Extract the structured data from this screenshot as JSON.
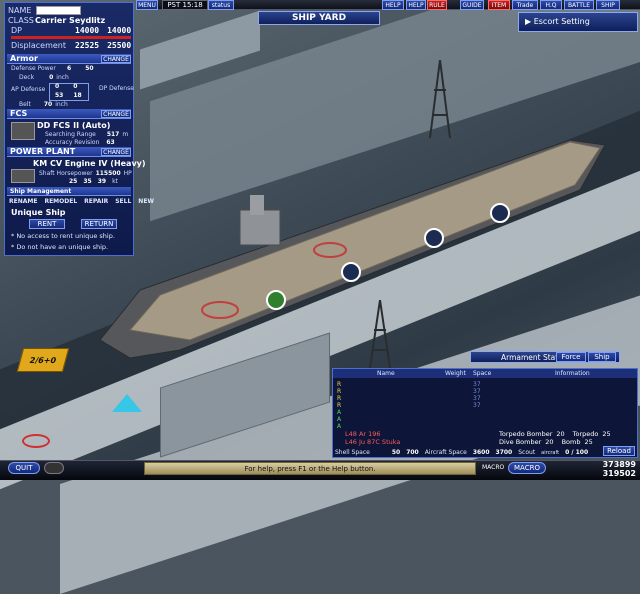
{
  "colors": {
    "panel": "#142266",
    "accent": "#3a5bc0",
    "danger": "#c22222",
    "menu_red": "#b01818",
    "target_green": "#2f7f2f"
  },
  "topbar": {
    "menu_label": "MENU",
    "time": "PST 15:18",
    "status": "status",
    "help": "HELP",
    "help2": "HELP",
    "rule": "RULE",
    "guide": "GUIDE",
    "item": "ITEM",
    "trade": "Trade",
    "hq": "H.Q",
    "battle": "BATTLE",
    "ship": "SHIP",
    "location": "SHIP YARD"
  },
  "info_panel": {
    "name_label": "NAME",
    "class_label": "CLASS",
    "class_value": "Carrier Seydlitz",
    "dp_label": "DP",
    "dp_value": "14000",
    "dp_max": "14000",
    "disp_label": "Displacement",
    "disp_value": "22525",
    "disp_max": "25500"
  },
  "armor": {
    "title": "Armor",
    "change": "CHANGE",
    "defense_power_label": "Defense Power",
    "defense_power_values": [
      "6",
      "50"
    ],
    "deck_label": "Deck",
    "deck_value": "0",
    "deck_unit": "inch",
    "ap_label": "AP Defense",
    "ap_values": [
      "0",
      "0",
      "53",
      "18"
    ],
    "dp_def_label": "DP Defense",
    "belt_label": "Belt",
    "belt_value": "70",
    "belt_unit": "inch"
  },
  "fcs": {
    "title": "FCS",
    "change": "CHANGE",
    "name": "DD FCS II (Auto)",
    "range_label": "Searching Range",
    "range_value": "517",
    "range_unit": "m",
    "acc_label": "Accuracy Revision",
    "acc_value": "63"
  },
  "power": {
    "title": "POWER PLANT",
    "change": "CHANGE",
    "name": "KM CV Engine IV (Heavy)",
    "hp_label": "Shaft Horsepower",
    "hp_value": "115500",
    "hp_unit": "HP",
    "speeds": [
      "25",
      "35",
      "39"
    ],
    "speed_unit": "kt"
  },
  "ship_mgmt": {
    "title": "Ship Management",
    "rename": "RENAME",
    "remodel": "REMODEL",
    "repair": "REPAIR",
    "sell": "SELL",
    "new": "NEW"
  },
  "unique": {
    "title": "Unique Ship",
    "rent": "RENT",
    "return": "RETURN",
    "note1": "* No access to rent unique ship.",
    "note2": "* Do not have an unique ship."
  },
  "escort": {
    "label": "Escort Setting"
  },
  "armament": {
    "title": "Armament Status",
    "tab_force": "Force",
    "tab_ship": "Ship",
    "headers": {
      "name": "Name",
      "weight": "Weight",
      "space": "Space",
      "info": "Information"
    },
    "slot_letters": [
      "R",
      "R",
      "R",
      "R",
      "A",
      "A",
      "A"
    ],
    "rows": [
      {
        "name": "L48 Ar 196",
        "weight": "",
        "space": ""
      },
      {
        "name": "L46 Ju 87C Stuka",
        "weight": "",
        "space": ""
      }
    ],
    "spaces": [
      "37",
      "37",
      "37",
      "37"
    ],
    "info": [
      {
        "label": "Torpedo Bomber",
        "value": "20",
        "label2": "Torpedo",
        "value2": "25"
      },
      {
        "label": "Dive Bomber",
        "value": "20",
        "label2": "Bomb",
        "value2": "25"
      }
    ],
    "shell_label": "Shell Space",
    "shell_val1": "50",
    "shell_val2": "700",
    "aircraft_label": "Aircraft Space",
    "aircraft_val1": "3600",
    "aircraft_val2": "3700",
    "scout_label": "Scout",
    "scout_sub": "aircraft",
    "scout_val": "0 / 100",
    "reload": "Reload"
  },
  "bottom": {
    "quit": "QUIT",
    "help_text": "For help, press F1 or the Help button.",
    "macro1": "MACRO",
    "macro2": "MACRO",
    "money1": "373899",
    "money2": "319502"
  },
  "scene": {
    "counter": "2/6+0"
  }
}
